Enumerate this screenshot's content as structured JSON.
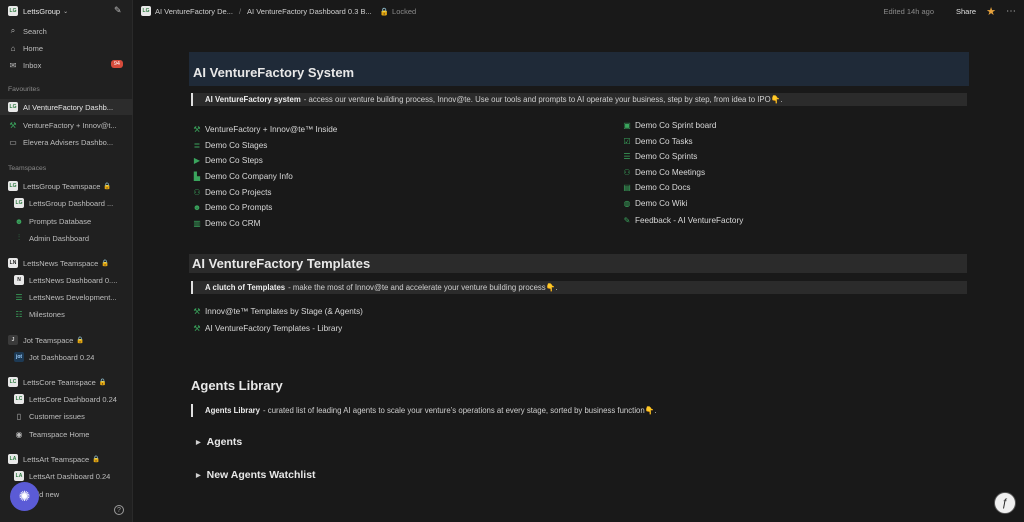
{
  "sidebar": {
    "workspace": "LettsGroup",
    "search": "Search",
    "home": "Home",
    "inbox": "Inbox",
    "inbox_badge": "94",
    "favourites_label": "Favourites",
    "favourites": [
      "AI VentureFactory Dashb...",
      "VentureFactory + Innov@t...",
      "Elevera Advisers Dashbo..."
    ],
    "teamspaces_label": "Teamspaces",
    "teamspaces": [
      {
        "name": "LettsGroup Teamspace",
        "logo": "LG",
        "items": [
          "LettsGroup Dashboard ...",
          "Prompts Database",
          "Admin Dashboard"
        ]
      },
      {
        "name": "LettsNews Teamspace",
        "logo": "LN",
        "items": [
          "LettsNews Dashboard 0....",
          "LettsNews Development...",
          "Milestones"
        ]
      },
      {
        "name": "Jot Teamspace",
        "logo": "J",
        "items": [
          "Jot Dashboard 0.24"
        ]
      },
      {
        "name": "LettsCore Teamspace",
        "logo": "LC",
        "items": [
          "LettsCore Dashboard 0.24",
          "Customer issues",
          "Teamspace Home"
        ]
      },
      {
        "name": "LettsArt Teamspace",
        "logo": "LA",
        "items": [
          "LettsArt Dashboard 0.24"
        ]
      }
    ],
    "add_new": "Add new"
  },
  "topbar": {
    "crumb1": "AI VentureFactory De...",
    "separator": "/",
    "crumb2": "AI VentureFactory Dashboard 0.3 B...",
    "locked": "Locked",
    "edited": "Edited 14h ago",
    "share": "Share"
  },
  "main": {
    "title": "AI VentureFactory System",
    "system_quote_bold": "AI VentureFactory system",
    "system_quote_rest": "- access our venture building process, Innov@te. Use our tools and prompts to AI operate your business, step by step, from idea to IPO👇.",
    "left_links": [
      "VentureFactory + Innov@te™ Inside",
      "Demo Co Stages",
      "Demo Co Steps",
      "Demo Co Company Info",
      "Demo Co Projects",
      "Demo Co Prompts",
      "Demo Co CRM"
    ],
    "right_links": [
      "Demo Co Sprint board",
      "Demo Co Tasks",
      "Demo Co Sprints",
      "Demo Co Meetings",
      "Demo Co Docs",
      "Demo Co Wiki",
      "Feedback - AI VentureFactory"
    ],
    "templates_title": "AI VentureFactory Templates",
    "templates_quote_bold": "A clutch of Templates",
    "templates_quote_rest": "- make the most of Innov@te and accelerate your venture building process👇.",
    "template_links": [
      "Innov@te™ Templates by Stage (& Agents)",
      "AI VentureFactory Templates - Library"
    ],
    "agents_title": "Agents Library",
    "agents_quote_bold": "Agents Library",
    "agents_quote_rest": "- curated list of leading AI agents to scale your venture’s operations at every stage, sorted by business function👇.",
    "toggles": [
      "Agents",
      "New Agents Watchlist"
    ]
  },
  "colors": {
    "accent_green": "#3aa55d",
    "title_bg": "#1f2a38",
    "star": "#e8a33d"
  }
}
